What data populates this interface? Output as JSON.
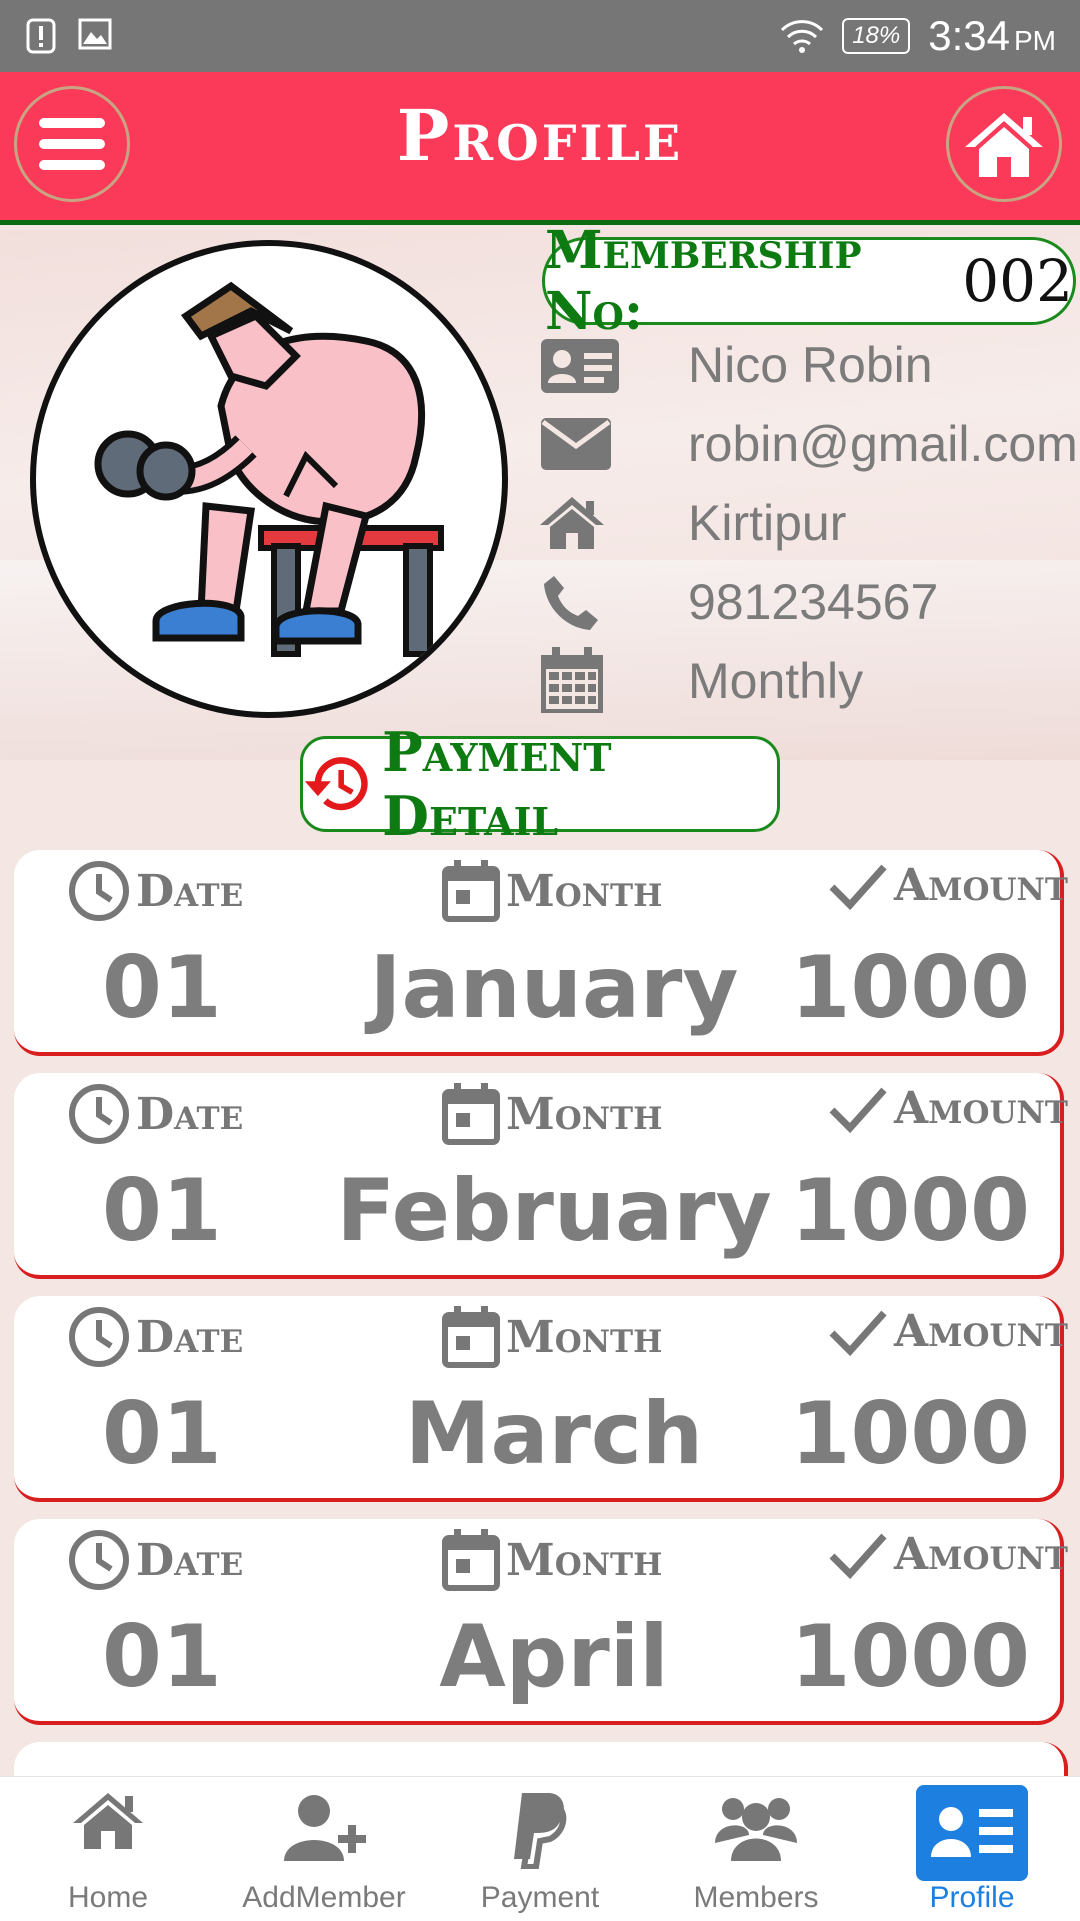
{
  "status_bar": {
    "battery": "18%",
    "time": "3:34",
    "ampm": "PM"
  },
  "header": {
    "title": "Profile"
  },
  "profile": {
    "membership_label": "Membership No:",
    "membership_no": "002",
    "name": "Nico Robin",
    "email": "robin@gmail.com",
    "address": "Kirtipur",
    "phone": "981234567",
    "plan": "Monthly"
  },
  "payment_button": {
    "label": "Payment Detail"
  },
  "payments": {
    "headers": {
      "date": "Date",
      "month": "Month",
      "amount": "Amount"
    },
    "rows": [
      {
        "date": "01",
        "month": "January",
        "amount": "1000"
      },
      {
        "date": "01",
        "month": "February",
        "amount": "1000"
      },
      {
        "date": "01",
        "month": "March",
        "amount": "1000"
      },
      {
        "date": "01",
        "month": "April",
        "amount": "1000"
      }
    ]
  },
  "nav": {
    "items": [
      {
        "label": "Home",
        "icon": "home-icon"
      },
      {
        "label": "AddMember",
        "icon": "add-user-icon"
      },
      {
        "label": "Payment",
        "icon": "paypal-icon"
      },
      {
        "label": "Members",
        "icon": "group-icon"
      },
      {
        "label": "Profile",
        "icon": "id-card-icon"
      }
    ],
    "active": "Profile"
  },
  "colors": {
    "header": "#fb3a5a",
    "accent_green": "#0e7a12",
    "card_border": "#d81e1e",
    "active_nav": "#1d7fe0"
  }
}
